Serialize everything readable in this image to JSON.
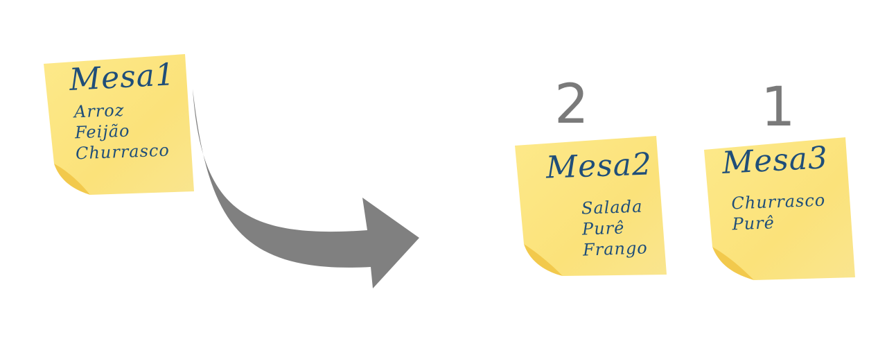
{
  "notes": [
    {
      "title": "Mesa1",
      "items": [
        "Arroz",
        "Feijão",
        "Churrasco"
      ]
    },
    {
      "title": "Mesa2",
      "items": [
        "Salada",
        "Purê",
        "Frango"
      ],
      "badge": "2"
    },
    {
      "title": "Mesa3",
      "items": [
        "Churrasco",
        "Purê"
      ],
      "badge": "1"
    }
  ],
  "colors": {
    "note": "#fbe77a",
    "note_dark": "#f2c94c",
    "text": "#1f4e79",
    "arrow": "#808080",
    "badge": "#7a7a7a"
  },
  "icons": [
    "sticky-note",
    "curved-arrow"
  ]
}
